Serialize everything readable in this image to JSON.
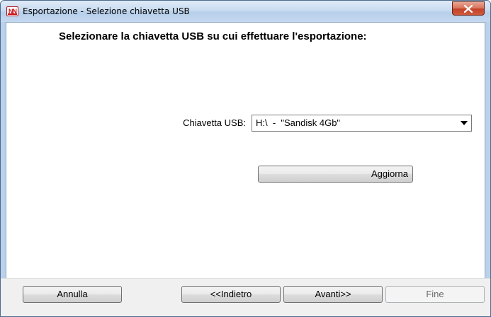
{
  "window": {
    "title": "Esportazione - Selezione chiavetta USB",
    "app_icon_text": "NN",
    "close_icon": "close-icon"
  },
  "main": {
    "heading": "Selezionare la chiavetta USB su cui effettuare l'esportazione:",
    "usb_label": "Chiavetta USB:",
    "usb_selected": "H:\\  -  \"Sandisk 4Gb\"",
    "refresh_label": "Aggiorna"
  },
  "footer": {
    "cancel_label": "Annulla",
    "back_label": "<<Indietro",
    "next_label": "Avanti>>",
    "finish_label": "Fine"
  },
  "colors": {
    "close_button": "#c2432a",
    "window_frame": "#b9d1ea",
    "app_icon": "#c8161d",
    "disabled_text": "#6d6d6d"
  }
}
